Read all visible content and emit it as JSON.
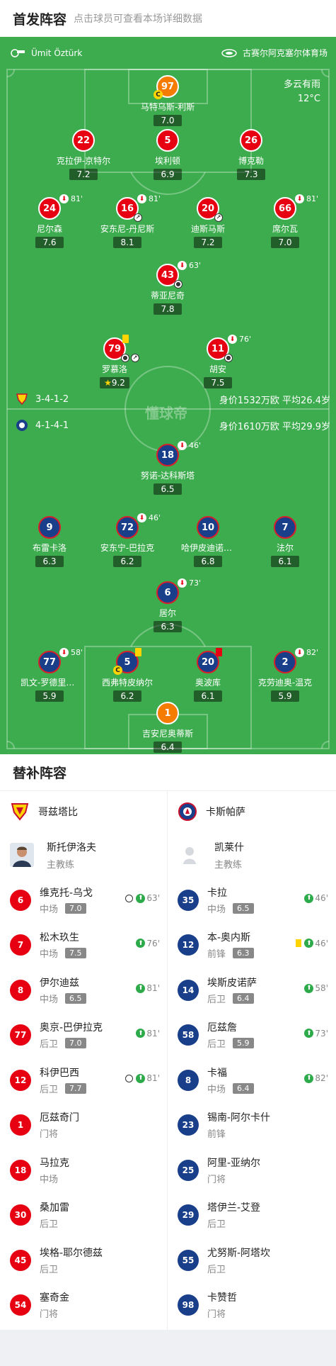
{
  "header": {
    "title": "首发阵容",
    "subtitle": "点击球员可查看本场详细数据"
  },
  "pitch": {
    "referee": "Ümit Öztürk",
    "stadium": "古赛尔阿克塞尔体育场",
    "weather": "多云有雨",
    "temperature": "12°C",
    "watermark": "懂球帝",
    "home_formation": "3-4-1-2",
    "home_value": "身价1532万欧 平均26.4岁",
    "away_formation": "4-1-4-1",
    "away_value": "身价1610万欧 平均29.9岁"
  },
  "home_players": [
    {
      "num": "97",
      "name": "马特乌斯-利斯",
      "rating": "7.0",
      "sub": "",
      "captain": true
    },
    {
      "num": "22",
      "name": "克拉伊-京特尔",
      "rating": "7.2",
      "sub": ""
    },
    {
      "num": "5",
      "name": "埃利顿",
      "rating": "6.9",
      "sub": ""
    },
    {
      "num": "26",
      "name": "博克勒",
      "rating": "7.3",
      "sub": ""
    },
    {
      "num": "24",
      "name": "尼尔森",
      "rating": "7.6",
      "sub": "81'"
    },
    {
      "num": "16",
      "name": "安东尼-丹尼斯",
      "rating": "8.1",
      "sub": "81'"
    },
    {
      "num": "20",
      "name": "迪斯马斯",
      "rating": "7.2",
      "sub": ""
    },
    {
      "num": "66",
      "name": "席尔瓦",
      "rating": "7.0",
      "sub": "81'"
    },
    {
      "num": "43",
      "name": "蒂亚尼奇",
      "rating": "7.8",
      "sub": "63'"
    },
    {
      "num": "79",
      "name": "罗慕洛",
      "rating": "9.2",
      "sub": ""
    },
    {
      "num": "11",
      "name": "胡安",
      "rating": "7.5",
      "sub": "76'"
    }
  ],
  "away_players": [
    {
      "num": "18",
      "name": "努诺-达科斯塔",
      "rating": "6.5",
      "sub": "46'"
    },
    {
      "num": "9",
      "name": "布雷卡洛",
      "rating": "6.3",
      "sub": ""
    },
    {
      "num": "72",
      "name": "安东宁-巴拉克",
      "rating": "6.2",
      "sub": "46'"
    },
    {
      "num": "10",
      "name": "哈伊皮迪诺维奇",
      "rating": "6.8",
      "sub": ""
    },
    {
      "num": "7",
      "name": "法尔",
      "rating": "6.1",
      "sub": ""
    },
    {
      "num": "6",
      "name": "居尔",
      "rating": "6.3",
      "sub": "73'"
    },
    {
      "num": "77",
      "name": "凯文-罗德里格斯",
      "rating": "5.9",
      "sub": "58'"
    },
    {
      "num": "5",
      "name": "西弗特皮纳尔",
      "rating": "6.2",
      "sub": "",
      "captain": true
    },
    {
      "num": "20",
      "name": "奥波库",
      "rating": "6.1",
      "sub": ""
    },
    {
      "num": "2",
      "name": "克劳迪奥-温克",
      "rating": "5.9",
      "sub": "82'"
    },
    {
      "num": "1",
      "name": "吉安尼奥蒂斯",
      "rating": "6.4",
      "sub": ""
    }
  ],
  "bench": {
    "title": "替补阵容",
    "home": {
      "team": "哥兹塔比",
      "coach": "斯托伊洛夫",
      "coach_role": "主教练",
      "subs": [
        {
          "num": "6",
          "name": "维克托-乌戈",
          "pos": "中场",
          "rating": "7.0",
          "time": "63'",
          "goal": true
        },
        {
          "num": "7",
          "name": "松木玖生",
          "pos": "中场",
          "rating": "7.5",
          "time": "76'"
        },
        {
          "num": "8",
          "name": "伊尔迪兹",
          "pos": "中场",
          "rating": "6.5",
          "time": "81'"
        },
        {
          "num": "77",
          "name": "奥京-巴伊拉克",
          "pos": "后卫",
          "rating": "7.0",
          "time": "81'"
        },
        {
          "num": "12",
          "name": "科伊巴西",
          "pos": "后卫",
          "rating": "7.7",
          "time": "81'",
          "goal": true
        },
        {
          "num": "1",
          "name": "厄兹奇门",
          "pos": "门将",
          "rating": "",
          "time": ""
        },
        {
          "num": "18",
          "name": "马拉克",
          "pos": "中场",
          "rating": "",
          "time": ""
        },
        {
          "num": "30",
          "name": "桑加雷",
          "pos": "后卫",
          "rating": "",
          "time": ""
        },
        {
          "num": "45",
          "name": "埃格-耶尔德兹",
          "pos": "后卫",
          "rating": "",
          "time": ""
        },
        {
          "num": "54",
          "name": "塞奇金",
          "pos": "门将",
          "rating": "",
          "time": ""
        }
      ]
    },
    "away": {
      "team": "卡斯帕萨",
      "coach": "凯莱什",
      "coach_role": "主教练",
      "subs": [
        {
          "num": "35",
          "name": "卡拉",
          "pos": "中场",
          "rating": "6.5",
          "time": "46'"
        },
        {
          "num": "12",
          "name": "本-奥内斯",
          "pos": "前锋",
          "rating": "6.3",
          "time": "46'",
          "yellow": true
        },
        {
          "num": "14",
          "name": "埃斯皮诺萨",
          "pos": "后卫",
          "rating": "6.4",
          "time": "58'"
        },
        {
          "num": "58",
          "name": "厄兹詹",
          "pos": "后卫",
          "rating": "5.9",
          "time": "73'"
        },
        {
          "num": "8",
          "name": "卡福",
          "pos": "中场",
          "rating": "6.4",
          "time": "82'"
        },
        {
          "num": "23",
          "name": "锡南-阿尔卡什",
          "pos": "前锋",
          "rating": "",
          "time": ""
        },
        {
          "num": "25",
          "name": "阿里-亚纳尔",
          "pos": "门将",
          "rating": "",
          "time": ""
        },
        {
          "num": "29",
          "name": "塔伊兰-艾登",
          "pos": "后卫",
          "rating": "",
          "time": ""
        },
        {
          "num": "55",
          "name": "尤努斯-阿塔坎",
          "pos": "后卫",
          "rating": "",
          "time": ""
        },
        {
          "num": "98",
          "name": "卡赞哲",
          "pos": "门将",
          "rating": "",
          "time": ""
        }
      ]
    }
  }
}
